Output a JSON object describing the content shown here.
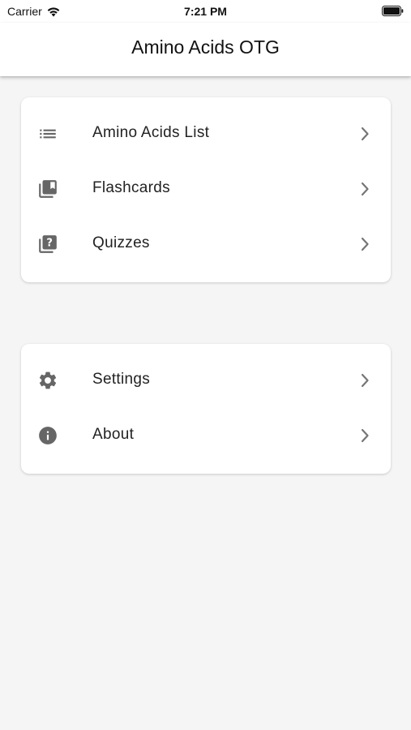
{
  "status_bar": {
    "carrier": "Carrier",
    "time": "7:21 PM",
    "wifi_icon": "wifi-icon",
    "battery_icon": "battery-icon"
  },
  "app_bar": {
    "title": "Amino Acids OTG"
  },
  "sections": {
    "main": [
      {
        "label": "Amino Acids List",
        "icon": "list-icon"
      },
      {
        "label": "Flashcards",
        "icon": "library-books-icon"
      },
      {
        "label": "Quizzes",
        "icon": "quiz-icon"
      }
    ],
    "secondary": [
      {
        "label": "Settings",
        "icon": "gear-icon"
      },
      {
        "label": "About",
        "icon": "info-icon"
      }
    ]
  },
  "colors": {
    "background": "#f5f5f5",
    "card": "#ffffff",
    "icon": "#666666",
    "chevron": "#757575",
    "text": "#222222"
  }
}
